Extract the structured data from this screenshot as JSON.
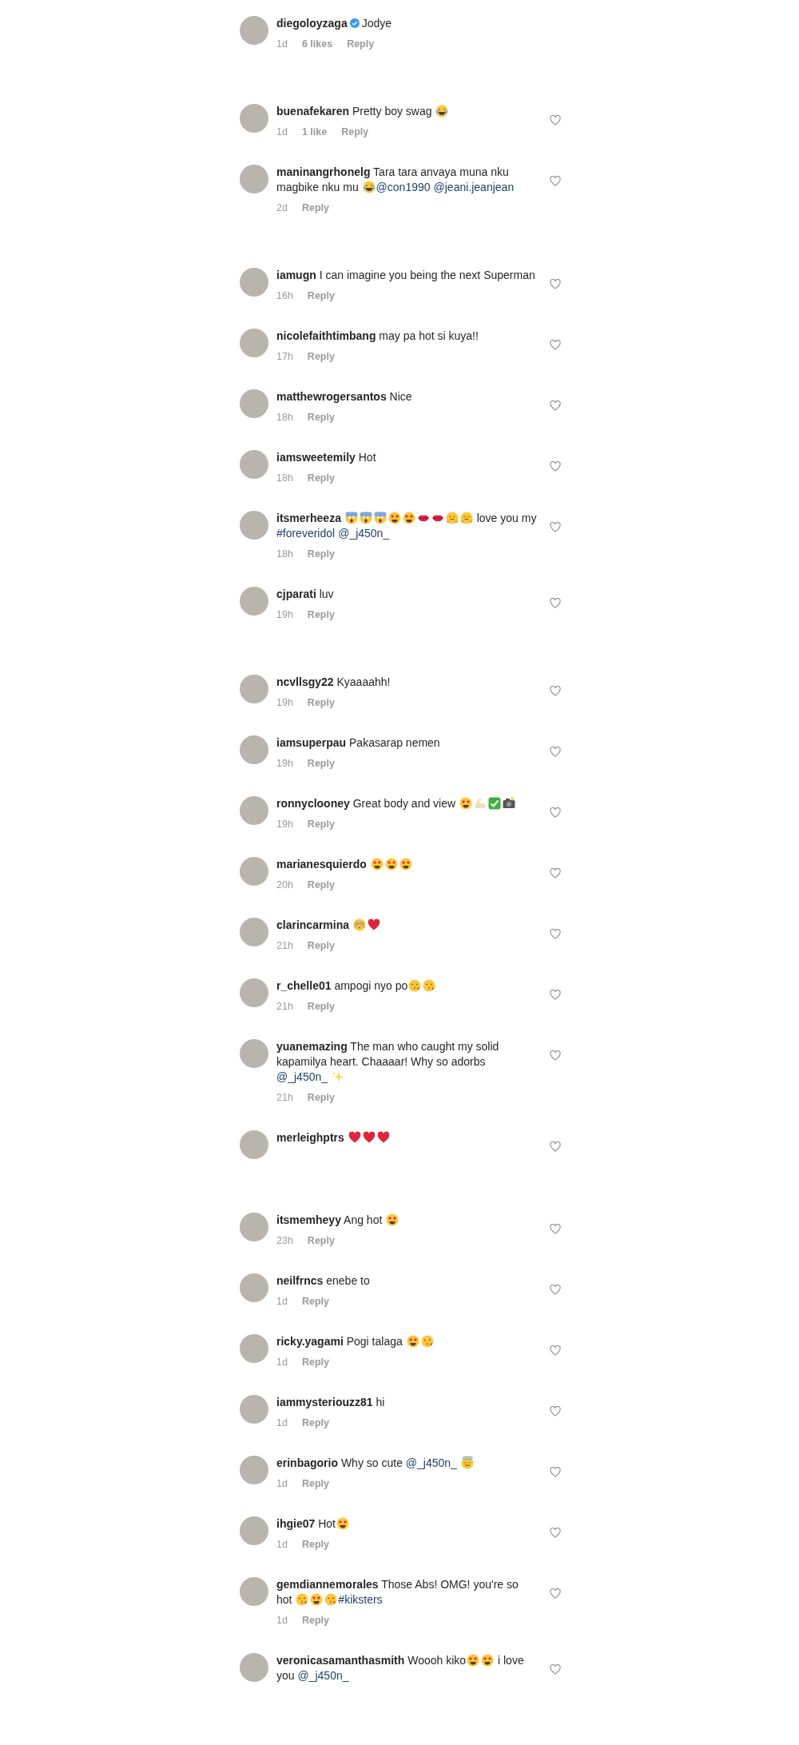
{
  "groups": [
    {
      "comments": [
        {
          "kind": "caption",
          "user": "diegoloyzaga",
          "verified": true,
          "body": [
            {
              "kind": "text",
              "text": "Jodye"
            }
          ],
          "time": "1d",
          "likes": "6 likes",
          "reply": "Reply"
        }
      ]
    },
    {
      "comments": [
        {
          "kind": "comment",
          "user": "buenafekaren",
          "body": [
            {
              "kind": "text",
              "text": "Pretty boy swag "
            },
            {
              "kind": "joy"
            }
          ],
          "time": "1d",
          "likes": "1 like",
          "reply": "Reply"
        },
        {
          "kind": "comment",
          "user": "maninangrhonelg",
          "body": [
            {
              "kind": "text",
              "text": "Tara tara anvaya muna nku magbike nku mu "
            },
            {
              "kind": "joy"
            },
            {
              "kind": "tag",
              "text": "@con1990"
            },
            {
              "kind": "tag",
              "text": "@jeani.jeanjean"
            }
          ],
          "time": "2d",
          "reply": "Reply"
        }
      ]
    },
    {
      "comments": [
        {
          "kind": "comment",
          "user": "iamugn",
          "body": [
            {
              "kind": "text",
              "text": "I can imagine you being the next Superman"
            }
          ],
          "time": "16h",
          "reply": "Reply"
        },
        {
          "kind": "comment",
          "user": "nicolefaithtimbang",
          "body": [
            {
              "kind": "text",
              "text": "may pa hot si kuya!!"
            }
          ],
          "time": "17h",
          "reply": "Reply"
        },
        {
          "kind": "comment",
          "user": "matthewrogersantos",
          "body": [
            {
              "kind": "text",
              "text": "Nice"
            }
          ],
          "time": "18h",
          "reply": "Reply"
        },
        {
          "kind": "comment",
          "user": "iamsweetemily",
          "body": [
            {
              "kind": "text",
              "text": "Hot"
            }
          ],
          "time": "18h",
          "reply": "Reply"
        },
        {
          "kind": "comment",
          "user": "itsmerheeza",
          "body": [
            {
              "kind": "scream"
            },
            {
              "kind": "scream"
            },
            {
              "kind": "scream"
            },
            {
              "kind": "heart-eyes"
            },
            {
              "kind": "heart-eyes"
            },
            {
              "kind": "lips"
            },
            {
              "kind": "lips"
            },
            {
              "kind": "hug"
            },
            {
              "kind": "hug"
            },
            {
              "kind": "text",
              "text": " love you my "
            },
            {
              "kind": "tag",
              "text": "#foreveridol"
            },
            {
              "kind": "tag",
              "text": "@_j450n_"
            }
          ],
          "time": "18h",
          "reply": "Reply"
        },
        {
          "kind": "comment",
          "user": "cjparati",
          "body": [
            {
              "kind": "text",
              "text": "luv"
            }
          ],
          "time": "19h",
          "reply": "Reply"
        }
      ]
    },
    {
      "comments": [
        {
          "kind": "comment",
          "user": "ncvllsgy22",
          "body": [
            {
              "kind": "text",
              "text": "Kyaaaahh!"
            }
          ],
          "time": "19h",
          "reply": "Reply"
        },
        {
          "kind": "comment",
          "user": "iamsuperpau",
          "body": [
            {
              "kind": "text",
              "text": "Pakasarap nemen"
            }
          ],
          "time": "19h",
          "reply": "Reply"
        },
        {
          "kind": "comment",
          "user": "ronnyclooney",
          "body": [
            {
              "kind": "text",
              "text": "Great body and view "
            },
            {
              "kind": "heart-eyes"
            },
            {
              "kind": "muscle"
            },
            {
              "kind": "check"
            },
            {
              "kind": "camera"
            }
          ],
          "time": "19h",
          "reply": "Reply"
        },
        {
          "kind": "comment",
          "user": "marianesquierdo",
          "body": [
            {
              "kind": "heart-eyes"
            },
            {
              "kind": "heart-eyes"
            },
            {
              "kind": "heart-eyes"
            }
          ],
          "time": "20h",
          "reply": "Reply"
        },
        {
          "kind": "comment",
          "user": "clarincarmina",
          "body": [
            {
              "kind": "flushed"
            },
            {
              "kind": "heart"
            }
          ],
          "time": "21h",
          "reply": "Reply"
        },
        {
          "kind": "comment",
          "user": "r_chelle01",
          "body": [
            {
              "kind": "text",
              "text": "ampogi nyo po"
            },
            {
              "kind": "kiss"
            },
            {
              "kind": "kiss"
            }
          ],
          "time": "21h",
          "reply": "Reply"
        },
        {
          "kind": "comment",
          "user": "yuanemazing",
          "body": [
            {
              "kind": "text",
              "text": "The man who caught my solid kapamilya heart. Chaaaar! Why so adorbs "
            },
            {
              "kind": "tag",
              "text": "@_j450n_"
            },
            {
              "kind": "sparkles"
            }
          ],
          "time": "21h",
          "reply": "Reply"
        },
        {
          "kind": "comment",
          "user": "merleighptrs",
          "body": [
            {
              "kind": "heart"
            },
            {
              "kind": "heart"
            },
            {
              "kind": "heart"
            }
          ]
        }
      ]
    },
    {
      "comments": [
        {
          "kind": "comment",
          "user": "itsmemheyy",
          "body": [
            {
              "kind": "text",
              "text": "Ang hot "
            },
            {
              "kind": "heart-eyes"
            }
          ],
          "time": "23h",
          "reply": "Reply"
        },
        {
          "kind": "comment",
          "user": "neilfrncs",
          "body": [
            {
              "kind": "text",
              "text": "enebe to"
            }
          ],
          "time": "1d",
          "reply": "Reply"
        },
        {
          "kind": "comment",
          "user": "ricky.yagami",
          "body": [
            {
              "kind": "text",
              "text": "Pogi talaga "
            },
            {
              "kind": "heart-eyes"
            },
            {
              "kind": "kiss"
            }
          ],
          "time": "1d",
          "reply": "Reply"
        },
        {
          "kind": "comment",
          "user": "iammysteriouzz81",
          "body": [
            {
              "kind": "text",
              "text": "hi"
            }
          ],
          "time": "1d",
          "reply": "Reply"
        },
        {
          "kind": "comment",
          "user": "erinbagorio",
          "body": [
            {
              "kind": "text",
              "text": "Why so cute "
            },
            {
              "kind": "tag",
              "text": "@_j450n_"
            },
            {
              "kind": "halo"
            }
          ],
          "time": "1d",
          "reply": "Reply"
        },
        {
          "kind": "comment",
          "user": "ihgie07",
          "body": [
            {
              "kind": "text",
              "text": "Hot"
            },
            {
              "kind": "heart-eyes"
            }
          ],
          "time": "1d",
          "reply": "Reply"
        },
        {
          "kind": "comment",
          "user": "gemdiannemorales",
          "body": [
            {
              "kind": "text",
              "text": "Those Abs! OMG! you're so hot "
            },
            {
              "kind": "kiss"
            },
            {
              "kind": "heart-eyes"
            },
            {
              "kind": "kiss"
            },
            {
              "kind": "tag",
              "text": "#kiksters"
            }
          ],
          "time": "1d",
          "reply": "Reply"
        },
        {
          "kind": "comment",
          "user": "veronicasamanthasmith",
          "body": [
            {
              "kind": "text",
              "text": "Woooh kiko"
            },
            {
              "kind": "heart-eyes"
            },
            {
              "kind": "heart-eyes"
            },
            {
              "kind": "text",
              "text": " i love you "
            },
            {
              "kind": "tag",
              "text": "@_j450n_"
            }
          ]
        }
      ]
    }
  ]
}
